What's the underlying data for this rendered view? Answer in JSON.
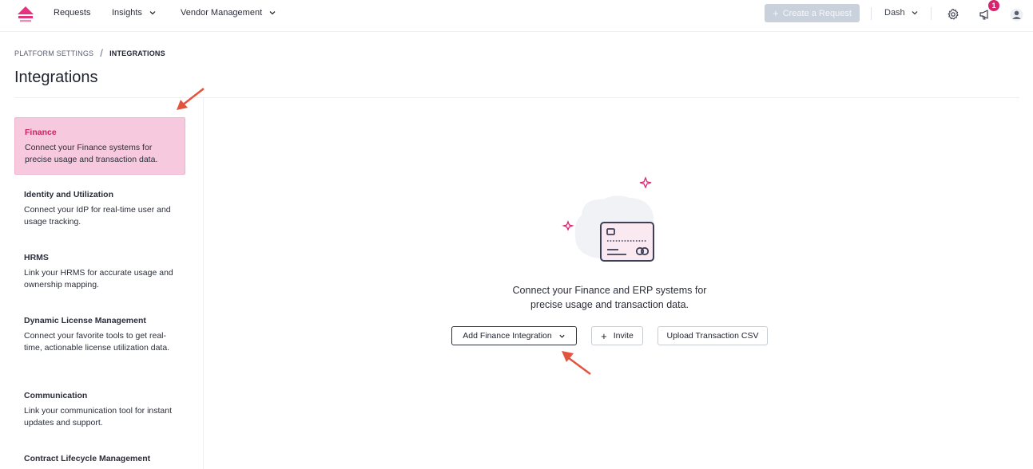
{
  "nav": {
    "items": [
      {
        "label": "Requests"
      },
      {
        "label": "Insights"
      },
      {
        "label": "Vendor Management"
      }
    ],
    "create_label": "Create a Request",
    "user_label": "Dash",
    "notification_count": "1",
    "icons": [
      "logo-icon",
      "gear-icon",
      "megaphone-icon",
      "user-icon"
    ]
  },
  "breadcrumb": {
    "parent": "PLATFORM SETTINGS",
    "separator": "/",
    "current": "INTEGRATIONS"
  },
  "page": {
    "title": "Integrations"
  },
  "sidebar": {
    "items": [
      {
        "title": "Finance",
        "desc": "Connect your Finance systems for precise usage and transaction data.",
        "active": true
      },
      {
        "title": "Identity and Utilization",
        "desc": "Connect your IdP for real-time user and usage tracking."
      },
      {
        "title": "HRMS",
        "desc": "Link your HRMS for accurate usage and ownership mapping."
      },
      {
        "title": "Dynamic License Management",
        "desc": "Connect your favorite tools to get real-time, actionable license utilization data."
      },
      {
        "title": "Communication",
        "desc": "Link your communication tool for instant updates and support."
      },
      {
        "title": "Contract Lifecycle Management",
        "desc": ""
      }
    ]
  },
  "main": {
    "line1": "Connect your Finance and ERP systems for",
    "line2": "precise usage and transaction data.",
    "add_label": "Add Finance Integration",
    "invite_label": "Invite",
    "upload_label": "Upload Transaction CSV"
  },
  "colors": {
    "accent": "#d6246e",
    "active_bg": "#f6c9de",
    "annotation_arrow": "#e2543d",
    "disabled_button": "#c9d1dc"
  }
}
